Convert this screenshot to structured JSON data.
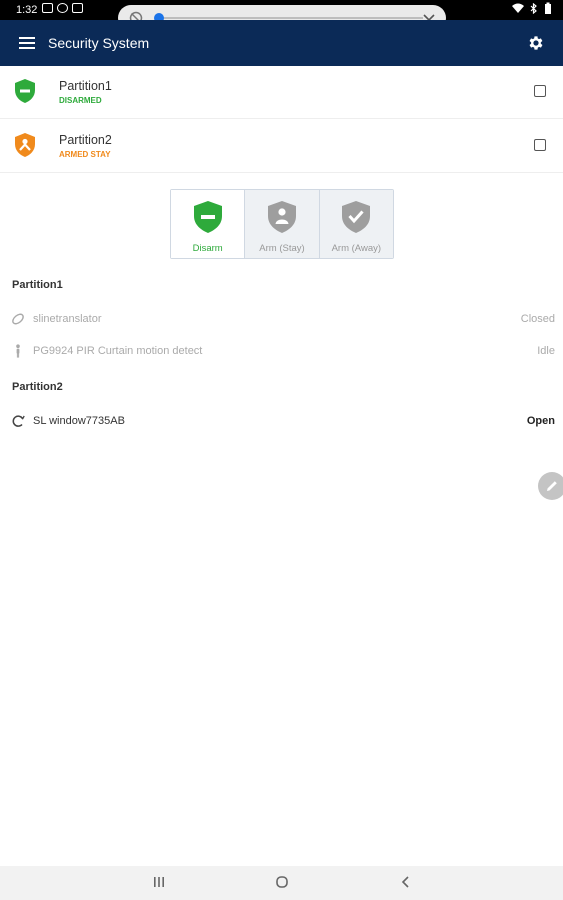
{
  "statusbar": {
    "time": "1:32"
  },
  "appbar": {
    "title": "Security System"
  },
  "partitions": [
    {
      "name": "Partition1",
      "status": "DISARMED",
      "color": "#2eaa3b"
    },
    {
      "name": "Partition2",
      "status": "ARMED STAY",
      "color": "#f08a1c"
    }
  ],
  "arm_controls": [
    {
      "label": "Disarm",
      "active": true
    },
    {
      "label": "Arm (Stay)",
      "active": false
    },
    {
      "label": "Arm (Away)",
      "active": false
    }
  ],
  "zones": {
    "partition1": {
      "heading": "Partition1",
      "items": [
        {
          "name": "slinetranslator",
          "state": "Closed",
          "icon": "oval-sensor-icon"
        },
        {
          "name": "PG9924 PIR Curtain motion detect",
          "state": "Idle",
          "icon": "motion-person-icon"
        }
      ]
    },
    "partition2": {
      "heading": "Partition2",
      "items": [
        {
          "name": "SL window7735AB",
          "state": "Open",
          "icon": "open-window-icon"
        }
      ]
    }
  },
  "colors": {
    "appbar": "#0b2a57",
    "disarmed": "#2eaa3b",
    "armed_stay": "#f08a1c",
    "inactive": "#999999"
  }
}
